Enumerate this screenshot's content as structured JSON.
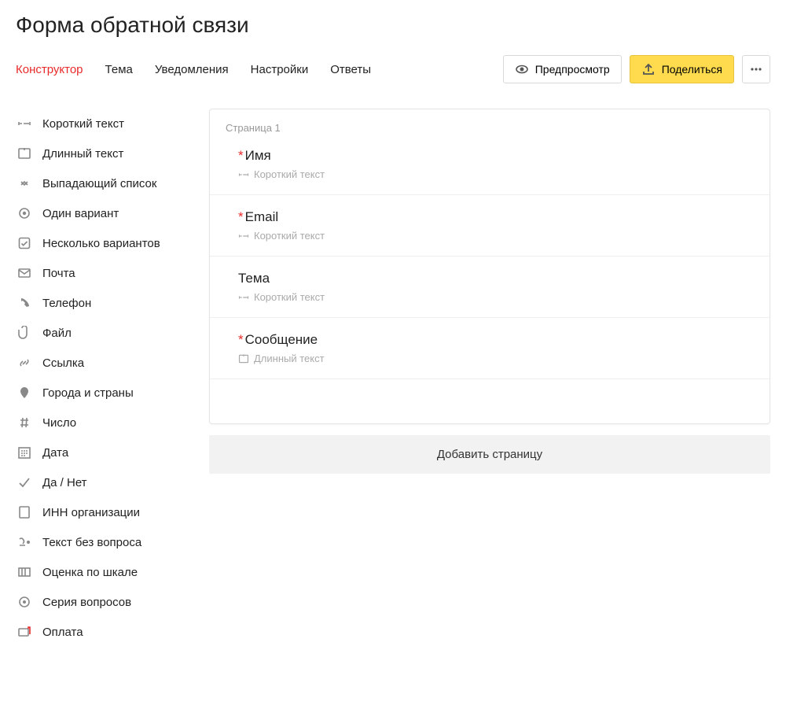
{
  "title": "Форма обратной связи",
  "tabs": [
    {
      "label": "Конструктор",
      "active": true
    },
    {
      "label": "Тема"
    },
    {
      "label": "Уведомления"
    },
    {
      "label": "Настройки"
    },
    {
      "label": "Ответы"
    }
  ],
  "toolbar": {
    "preview": "Предпросмотр",
    "share": "Поделиться"
  },
  "sidebar": {
    "items": [
      {
        "label": "Короткий текст",
        "icon": "short-text"
      },
      {
        "label": "Длинный текст",
        "icon": "long-text"
      },
      {
        "label": "Выпадающий список",
        "icon": "dropdown"
      },
      {
        "label": "Один вариант",
        "icon": "radio"
      },
      {
        "label": "Несколько вариантов",
        "icon": "checkbox"
      },
      {
        "label": "Почта",
        "icon": "mail"
      },
      {
        "label": "Телефон",
        "icon": "phone"
      },
      {
        "label": "Файл",
        "icon": "file"
      },
      {
        "label": "Ссылка",
        "icon": "link"
      },
      {
        "label": "Города и страны",
        "icon": "location"
      },
      {
        "label": "Число",
        "icon": "number"
      },
      {
        "label": "Дата",
        "icon": "date"
      },
      {
        "label": "Да / Нет",
        "icon": "yesno"
      },
      {
        "label": "ИНН организации",
        "icon": "org"
      },
      {
        "label": "Текст без вопроса",
        "icon": "text-noq"
      },
      {
        "label": "Оценка по шкале",
        "icon": "scale"
      },
      {
        "label": "Серия вопросов",
        "icon": "series"
      },
      {
        "label": "Оплата",
        "icon": "payment"
      }
    ]
  },
  "canvas": {
    "page_label": "Страница 1",
    "fields": [
      {
        "required": true,
        "title": "Имя",
        "type_label": "Короткий текст",
        "type_icon": "short-text"
      },
      {
        "required": true,
        "title": "Email",
        "type_label": "Короткий текст",
        "type_icon": "short-text"
      },
      {
        "required": false,
        "title": "Тема",
        "type_label": "Короткий текст",
        "type_icon": "short-text"
      },
      {
        "required": true,
        "title": "Сообщение",
        "type_label": "Длинный текст",
        "type_icon": "long-text"
      }
    ],
    "add_page": "Добавить страницу"
  }
}
